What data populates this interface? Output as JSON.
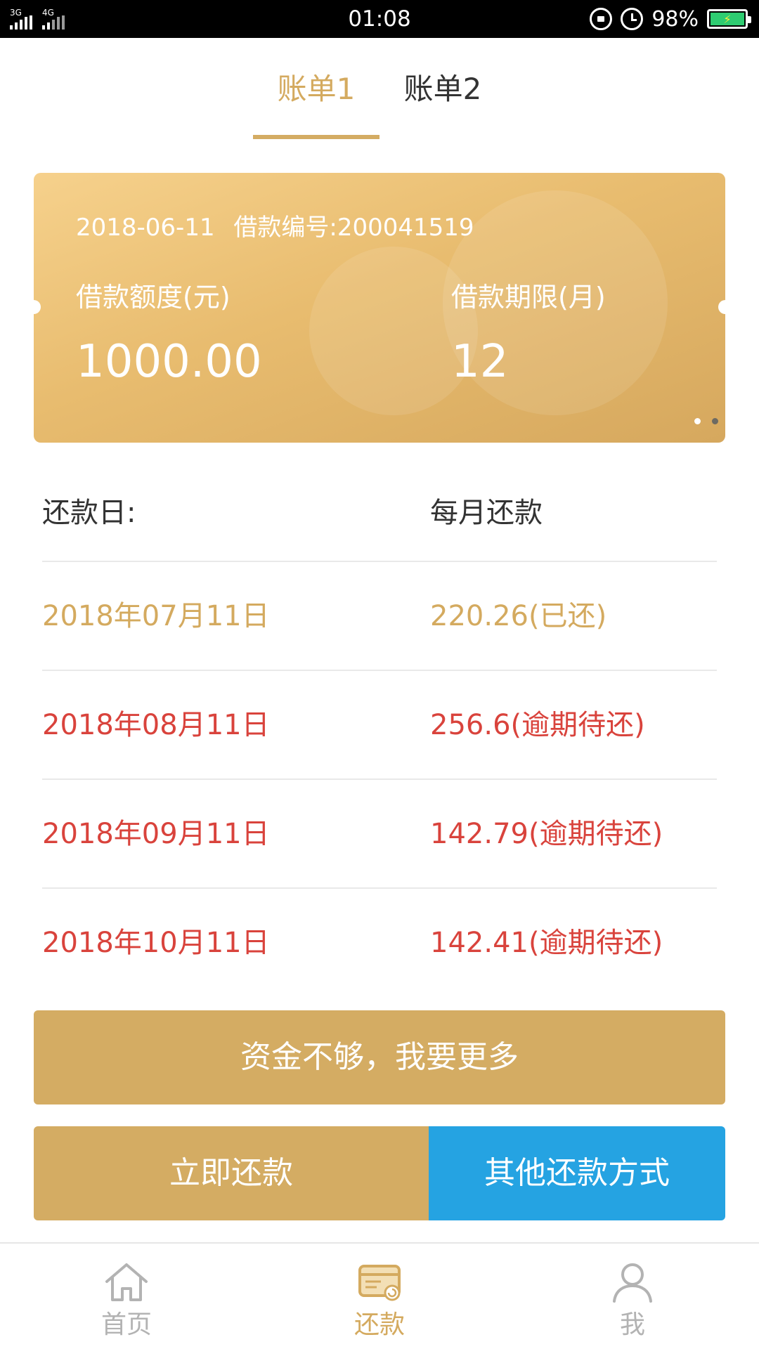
{
  "status_bar": {
    "network_left": "3G",
    "network_right": "4G",
    "time": "01:08",
    "battery_percent": "98%",
    "icons": [
      "lock-rotation-icon",
      "alarm-icon",
      "battery-icon"
    ]
  },
  "tabs": [
    {
      "label": "账单1",
      "active": true
    },
    {
      "label": "账单2",
      "active": false
    }
  ],
  "card": {
    "date": "2018-06-11",
    "loan_number": "借款编号:200041519",
    "amount_label": "借款额度(元)",
    "amount_value": "1000.00",
    "term_label": "借款期限(月)",
    "term_value": "12",
    "page_indicator": {
      "count": 2,
      "active_index": 1
    }
  },
  "schedule": {
    "headers": {
      "date": "还款日:",
      "amount": "每月还款"
    },
    "rows": [
      {
        "date": "2018年07月11日",
        "amount": "220.26(已还)",
        "status": "paid"
      },
      {
        "date": "2018年08月11日",
        "amount": "256.6(逾期待还)",
        "status": "overdue"
      },
      {
        "date": "2018年09月11日",
        "amount": "142.79(逾期待还)",
        "status": "overdue"
      },
      {
        "date": "2018年10月11日",
        "amount": "142.41(逾期待还)",
        "status": "overdue"
      }
    ]
  },
  "buttons": {
    "more_funds": "资金不够，我要更多",
    "pay_now": "立即还款",
    "other_methods": "其他还款方式"
  },
  "bottom_nav": [
    {
      "label": "首页",
      "icon": "home-icon",
      "active": false
    },
    {
      "label": "还款",
      "icon": "repay-card-icon",
      "active": true
    },
    {
      "label": "我",
      "icon": "user-icon",
      "active": false
    }
  ],
  "colors": {
    "gold": "#d4ac63",
    "overdue_red": "#d9433c",
    "blue": "#25a3e2"
  }
}
